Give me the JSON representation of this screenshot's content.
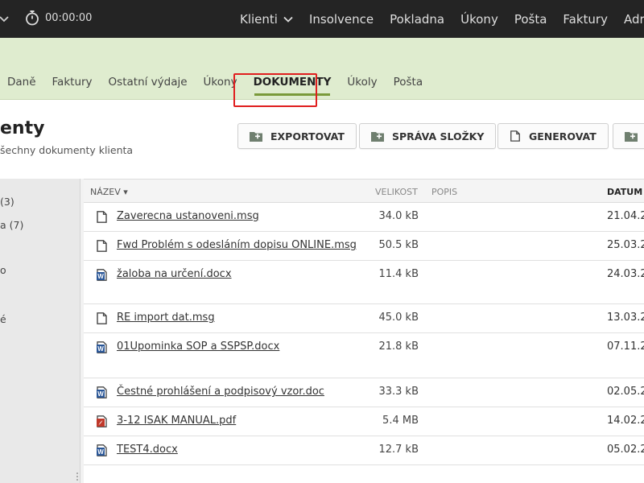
{
  "topbar": {
    "timer": "00:00:00",
    "nav": [
      {
        "label": "Klienti",
        "has_dropdown": true
      },
      {
        "label": "Insolvence"
      },
      {
        "label": "Pokladna"
      },
      {
        "label": "Úkony"
      },
      {
        "label": "Pošta"
      },
      {
        "label": "Faktury"
      },
      {
        "label": "Adresář"
      }
    ]
  },
  "subnav": {
    "tabs": [
      "Daně",
      "Faktury",
      "Ostatní výdaje",
      "Úkony",
      "DOKUMENTY",
      "Úkoly",
      "Pošta"
    ],
    "active_tab": "DOKUMENTY"
  },
  "page": {
    "title": "enty",
    "subtitle": "šechny dokumenty klienta"
  },
  "buttons": {
    "export": "EXPORTOVAT",
    "folders": "SPRÁVA SLOŽKY",
    "generate": "GENEROVAT"
  },
  "sidebar": {
    "items": [
      "(3)",
      "a (7)",
      "o",
      "é"
    ]
  },
  "table": {
    "headers": {
      "name": "NÁZEV ▾",
      "size": "VELIKOST",
      "desc": "POPIS",
      "date": "DATUM ⌃"
    },
    "rows": [
      {
        "icon": "file-icon",
        "name": "Zaverecna ustanoveni.msg",
        "size": "34.0 kB",
        "date": "21.04.2"
      },
      {
        "icon": "file-icon",
        "name": "Fwd Problém s odesláním dopisu ONLINE.msg",
        "size": "50.5 kB",
        "date": "25.03.2"
      },
      {
        "icon": "word-icon",
        "name": "žaloba na určení.docx",
        "size": "11.4 kB",
        "date": "24.03.2"
      },
      {
        "icon": "file-icon",
        "name": "RE import dat.msg",
        "size": "45.0 kB",
        "date": "13.03.2"
      },
      {
        "icon": "word-icon",
        "name": "01Upominka SOP a SSPSP.docx",
        "size": "21.8 kB",
        "date": "07.11.2"
      },
      {
        "icon": "word-icon",
        "name": "Čestné prohlášení a podpisový vzor.doc",
        "size": "33.3 kB",
        "date": "02.05.2"
      },
      {
        "icon": "pdf-icon",
        "name": "3-12 ISAK MANUAL.pdf",
        "size": "5.4 MB",
        "date": "14.02.2"
      },
      {
        "icon": "word-icon",
        "name": "TEST4.docx",
        "size": "12.7 kB",
        "date": "05.02.2"
      }
    ]
  },
  "colors": {
    "topbar": "#242424",
    "subnav": "#dfeccf",
    "active_underline": "#7a9a3a",
    "highlight": "#e01e1e",
    "word": "#2b5797",
    "pdf": "#c0392b"
  }
}
